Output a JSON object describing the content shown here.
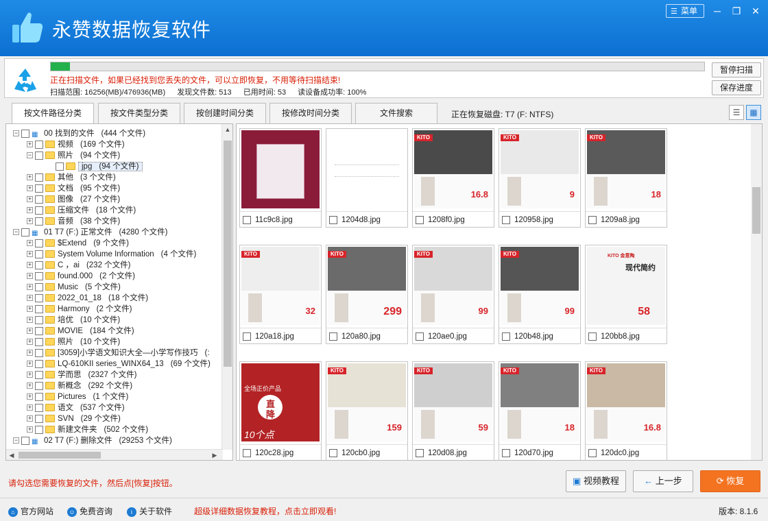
{
  "app": {
    "title": "永赞数据恢复软件",
    "menu_label": "菜单",
    "menu_icon": "hamburger-icon"
  },
  "scan": {
    "progress": 0.029,
    "message": "正在扫描文件，如果已经找到您丢失的文件，可以立即恢复，不用等待扫描结束!",
    "range": "扫描范围: 16256(MB)/476936(MB)",
    "found": "发现文件数: 513",
    "elapsed": "已用时间: 53",
    "success": "读设备成功率: 100%",
    "pause_label": "暂停扫描",
    "save_label": "保存进度"
  },
  "tabs": [
    "按文件路径分类",
    "按文件类型分类",
    "按创建时间分类",
    "按修改时间分类",
    "文件搜索"
  ],
  "disk_label": "正在恢复磁盘: T7 (F: NTFS)",
  "tree": [
    {
      "label": "00 找到的文件",
      "count": "(444 个文件)"
    },
    {
      "label": "视频",
      "count": "(169 个文件)"
    },
    {
      "label": "照片",
      "count": "(94 个文件)"
    },
    {
      "label": "jpg",
      "count": "(94 个文件)"
    },
    {
      "label": "其他",
      "count": "(3 个文件)"
    },
    {
      "label": "文档",
      "count": "(95 个文件)"
    },
    {
      "label": "图像",
      "count": "(27 个文件)"
    },
    {
      "label": "压缩文件",
      "count": "(18 个文件)"
    },
    {
      "label": "音频",
      "count": "(38 个文件)"
    },
    {
      "label": "01 T7 (F:) 正常文件",
      "count": "(4280 个文件)"
    },
    {
      "label": "$Extend",
      "count": "(9 个文件)"
    },
    {
      "label": "System Volume Information",
      "count": "(4 个文件)"
    },
    {
      "label": "C ，ai",
      "count": "(232 个文件)"
    },
    {
      "label": "found.000",
      "count": "(2 个文件)"
    },
    {
      "label": "Music",
      "count": "(5 个文件)"
    },
    {
      "label": "2022_01_18",
      "count": "(18 个文件)"
    },
    {
      "label": "Harmony",
      "count": "(2 个文件)"
    },
    {
      "label": "培优",
      "count": "(10 个文件)"
    },
    {
      "label": "MOVIE",
      "count": "(184 个文件)"
    },
    {
      "label": "照片",
      "count": "(10 个文件)"
    },
    {
      "label": "[3059]小学语文知识大全—小学写作技巧",
      "count": "(:"
    },
    {
      "label": "LQ-610KII series_WINX64_13",
      "count": "(69 个文件)"
    },
    {
      "label": "学而思",
      "count": "(2327 个文件)"
    },
    {
      "label": "新概念",
      "count": "(292 个文件)"
    },
    {
      "label": "Pictures",
      "count": "(1 个文件)"
    },
    {
      "label": "语文",
      "count": "(537 个文件)"
    },
    {
      "label": "SVN",
      "count": "(29 个文件)"
    },
    {
      "label": "新建文件夹",
      "count": "(502 个文件)"
    },
    {
      "label": "02 T7 (F:) 删除文件",
      "count": "(29253 个文件)"
    }
  ],
  "files": [
    {
      "name": "11c9c8.jpg"
    },
    {
      "name": "1204d8.jpg"
    },
    {
      "name": "1208f0.jpg"
    },
    {
      "name": "120958.jpg"
    },
    {
      "name": "1209a8.jpg"
    },
    {
      "name": "120a18.jpg"
    },
    {
      "name": "120a80.jpg"
    },
    {
      "name": "120ae0.jpg"
    },
    {
      "name": "120b48.jpg"
    },
    {
      "name": "120bb8.jpg"
    },
    {
      "name": "120c28.jpg"
    },
    {
      "name": "120cb0.jpg"
    },
    {
      "name": "120d08.jpg"
    },
    {
      "name": "120d70.jpg"
    },
    {
      "name": "120dc0.jpg"
    }
  ],
  "thumb_text": {
    "kito": "KITO",
    "p1": "16.8",
    "p2": "9",
    "p3": "18",
    "p4": "32",
    "p5": "299",
    "p6": "99",
    "p7": "99",
    "p8": "58",
    "p9": "159",
    "p10": "59",
    "p11": "18",
    "p12": "16.8",
    "modern": "现代简约",
    "kito_brand": "KITO 金意陶",
    "promo_line": "全场正价产品",
    "promo_big1": "直",
    "promo_big2": "降",
    "promo_pts": "10个点"
  },
  "hint": "请勾选您需要恢复的文件，然后点[恢复]按钮。",
  "buttons": {
    "video": "视频教程",
    "prev": "上一步",
    "recover": "恢复"
  },
  "status": {
    "website": "官方网站",
    "consult": "免费咨询",
    "about": "关于软件",
    "promo": "超级详细数据恢复教程，点击立即观看!",
    "version": "版本: 8.1.6"
  }
}
